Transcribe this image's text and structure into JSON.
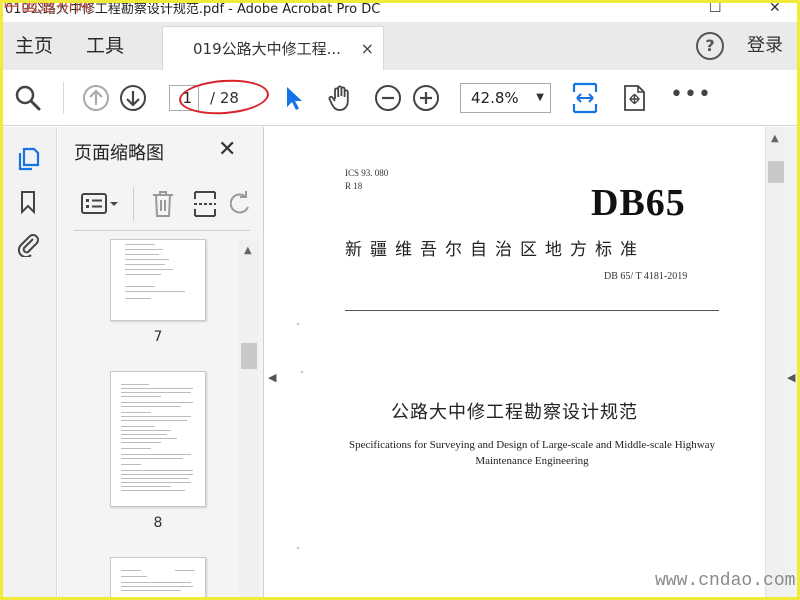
{
  "window": {
    "title": "019公路大中修工程勘察设计规范.pdf - Adobe Acrobat Pro DC",
    "watermark_top": "中国道桥网",
    "watermark_bottom": "www.cndao.com"
  },
  "tabbar": {
    "home_label": "主页",
    "tools_label": "工具",
    "doc_tab_label": "019公路大中修工程...",
    "doc_tab_close": "×",
    "help_label": "?",
    "login_label": "登录"
  },
  "toolbar": {
    "page_current": "1",
    "page_total": "/ 28",
    "zoom_value": "42.8%",
    "more_label": "•••"
  },
  "thumbnails": {
    "title": "页面缩略图",
    "close": "✕",
    "pages": [
      {
        "number": "7"
      },
      {
        "number": "8"
      }
    ]
  },
  "document": {
    "ics_line1": "ICS  93. 080",
    "ics_line2": "R 18",
    "code": "DB65",
    "standard_name": "新疆维吾尔自治区地方标准",
    "standard_number": "DB 65/ T 4181-2019",
    "cn_title": "公路大中修工程勘察设计规范",
    "en_title_line1": "Specifications for Surveying and Design of Large-scale and Middle-scale Highway",
    "en_title_line2": "Maintenance Engineering"
  },
  "colors": {
    "border": "#f0ea3a",
    "accent_blue": "#1473e6",
    "annotation_red": "#d8232a"
  }
}
